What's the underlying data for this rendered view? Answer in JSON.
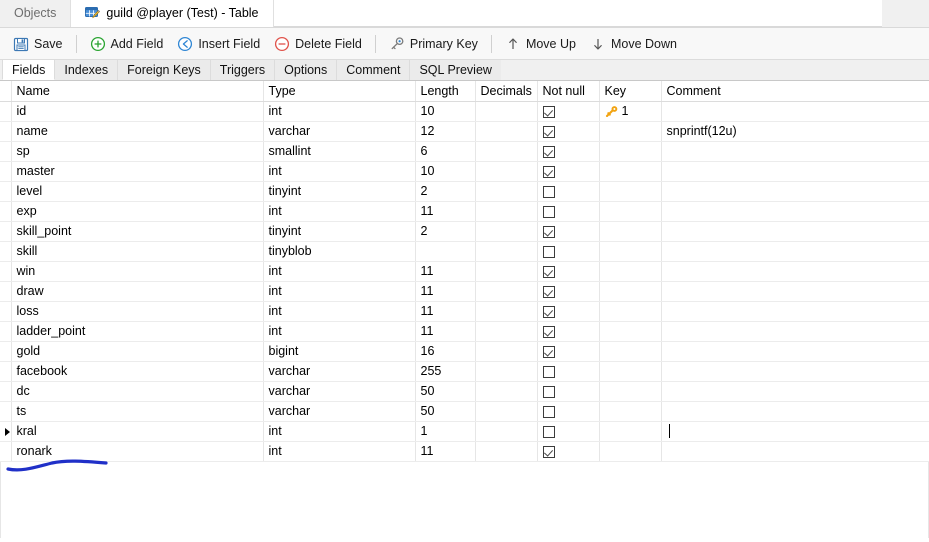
{
  "window": {
    "tabs": [
      {
        "label": "Objects",
        "icon": "none",
        "active": false
      },
      {
        "label": "guild @player (Test) - Table",
        "icon": "table-edit-icon",
        "active": true
      }
    ]
  },
  "toolbar": {
    "items": [
      {
        "label": "Save",
        "icon": "save-icon"
      },
      {
        "label": "Add Field",
        "icon": "plus-circle-icon"
      },
      {
        "label": "Insert Field",
        "icon": "insert-circle-icon"
      },
      {
        "label": "Delete Field",
        "icon": "minus-circle-icon"
      },
      {
        "label": "Primary Key",
        "icon": "key-icon"
      },
      {
        "label": "Move Up",
        "icon": "arrow-up-icon"
      },
      {
        "label": "Move Down",
        "icon": "arrow-down-icon"
      }
    ]
  },
  "subtabs": [
    {
      "label": "Fields",
      "active": true
    },
    {
      "label": "Indexes",
      "active": false
    },
    {
      "label": "Foreign Keys",
      "active": false
    },
    {
      "label": "Triggers",
      "active": false
    },
    {
      "label": "Options",
      "active": false
    },
    {
      "label": "Comment",
      "active": false
    },
    {
      "label": "SQL Preview",
      "active": false
    }
  ],
  "grid": {
    "columns": [
      "Name",
      "Type",
      "Length",
      "Decimals",
      "Not null",
      "Key",
      "Comment"
    ],
    "rows": [
      {
        "selected": false,
        "name": "id",
        "type": "int",
        "length": "10",
        "decimals": "",
        "notnull": true,
        "key": "1",
        "comment": ""
      },
      {
        "selected": false,
        "name": "name",
        "type": "varchar",
        "length": "12",
        "decimals": "",
        "notnull": true,
        "key": "",
        "comment": "snprintf(12u)"
      },
      {
        "selected": false,
        "name": "sp",
        "type": "smallint",
        "length": "6",
        "decimals": "",
        "notnull": true,
        "key": "",
        "comment": ""
      },
      {
        "selected": false,
        "name": "master",
        "type": "int",
        "length": "10",
        "decimals": "",
        "notnull": true,
        "key": "",
        "comment": ""
      },
      {
        "selected": false,
        "name": "level",
        "type": "tinyint",
        "length": "2",
        "decimals": "",
        "notnull": false,
        "key": "",
        "comment": ""
      },
      {
        "selected": false,
        "name": "exp",
        "type": "int",
        "length": "11",
        "decimals": "",
        "notnull": false,
        "key": "",
        "comment": ""
      },
      {
        "selected": false,
        "name": "skill_point",
        "type": "tinyint",
        "length": "2",
        "decimals": "",
        "notnull": true,
        "key": "",
        "comment": ""
      },
      {
        "selected": false,
        "name": "skill",
        "type": "tinyblob",
        "length": "",
        "decimals": "",
        "notnull": false,
        "key": "",
        "comment": ""
      },
      {
        "selected": false,
        "name": "win",
        "type": "int",
        "length": "11",
        "decimals": "",
        "notnull": true,
        "key": "",
        "comment": ""
      },
      {
        "selected": false,
        "name": "draw",
        "type": "int",
        "length": "11",
        "decimals": "",
        "notnull": true,
        "key": "",
        "comment": ""
      },
      {
        "selected": false,
        "name": "loss",
        "type": "int",
        "length": "11",
        "decimals": "",
        "notnull": true,
        "key": "",
        "comment": ""
      },
      {
        "selected": false,
        "name": "ladder_point",
        "type": "int",
        "length": "11",
        "decimals": "",
        "notnull": true,
        "key": "",
        "comment": ""
      },
      {
        "selected": false,
        "name": "gold",
        "type": "bigint",
        "length": "16",
        "decimals": "",
        "notnull": true,
        "key": "",
        "comment": ""
      },
      {
        "selected": false,
        "name": "facebook",
        "type": "varchar",
        "length": "255",
        "decimals": "",
        "notnull": false,
        "key": "",
        "comment": ""
      },
      {
        "selected": false,
        "name": "dc",
        "type": "varchar",
        "length": "50",
        "decimals": "",
        "notnull": false,
        "key": "",
        "comment": ""
      },
      {
        "selected": false,
        "name": "ts",
        "type": "varchar",
        "length": "50",
        "decimals": "",
        "notnull": false,
        "key": "",
        "comment": ""
      },
      {
        "selected": true,
        "name": "kral",
        "type": "int",
        "length": "1",
        "decimals": "",
        "notnull": false,
        "key": "",
        "comment": "",
        "editing_comment": true
      },
      {
        "selected": false,
        "name": "ronark",
        "type": "int",
        "length": "11",
        "decimals": "",
        "notnull": true,
        "key": "",
        "comment": ""
      }
    ]
  },
  "annotation": {
    "type": "ink-underline",
    "color": "#2030c8"
  },
  "colors": {
    "key_gold": "#f2a310",
    "add_green": "#2aa431",
    "insert_blue": "#2f86d4",
    "delete_red": "#e0524a",
    "tab_icon_blue": "#2b7cd3"
  }
}
